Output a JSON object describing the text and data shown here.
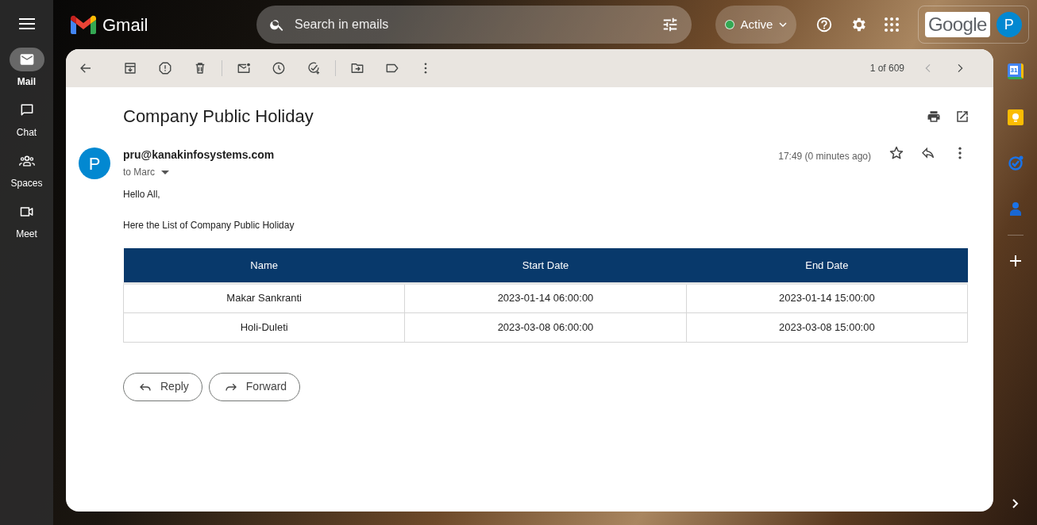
{
  "rail": {
    "items": [
      {
        "label": "Mail",
        "selected": true
      },
      {
        "label": "Chat",
        "selected": false
      },
      {
        "label": "Spaces",
        "selected": false
      },
      {
        "label": "Meet",
        "selected": false
      }
    ]
  },
  "header": {
    "app_name": "Gmail",
    "search": {
      "placeholder": "Search in emails"
    },
    "status": {
      "label": "Active"
    },
    "brand": "Google",
    "avatar": "P"
  },
  "toolbar": {
    "pagination": "1 of 609"
  },
  "email": {
    "subject": "Company Public Holiday",
    "avatar": "P",
    "sender": "pru@kanakinfosystems.com",
    "recipient": "to Marc",
    "time": "17:49 (0 minutes ago)",
    "starred": false,
    "paragraphs": [
      "Hello All,",
      "Here the List of Company Public Holiday"
    ],
    "table": {
      "columns": [
        "Name",
        "Start Date",
        "End Date"
      ],
      "rows": [
        [
          "Makar Sankranti",
          "2023-01-14 06:00:00",
          "2023-01-14 15:00:00"
        ],
        [
          "Holi-Duleti",
          "2023-03-08 06:00:00",
          "2023-03-08 15:00:00"
        ]
      ]
    },
    "actions": [
      {
        "label": "Reply",
        "kind": "reply"
      },
      {
        "label": "Forward",
        "kind": "forward"
      }
    ]
  },
  "side_panel": {
    "calendar_day": "31"
  }
}
